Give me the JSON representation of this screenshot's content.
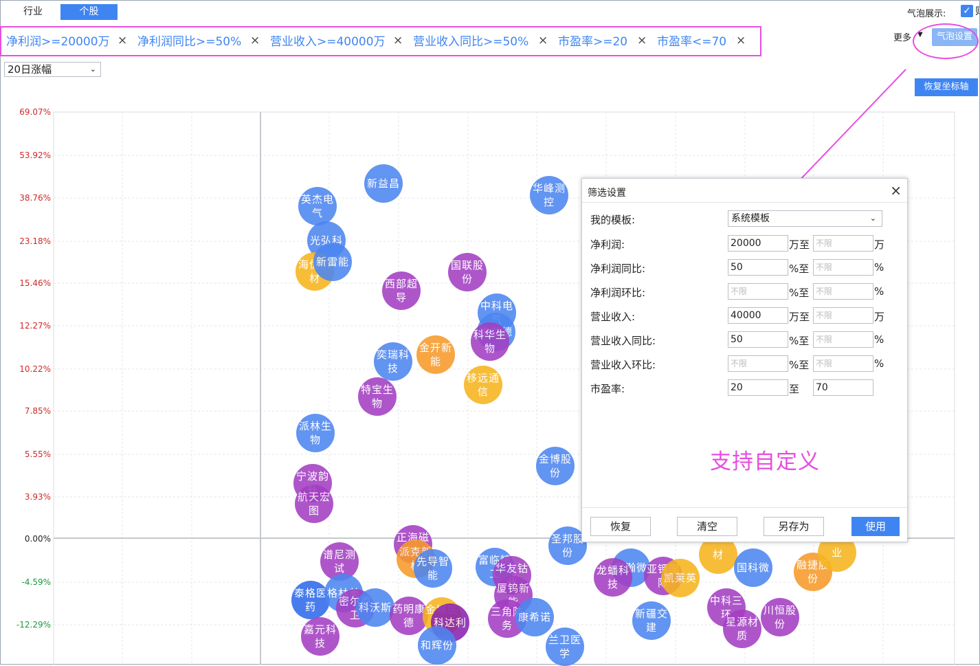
{
  "tabs": {
    "industry": "行业",
    "stock": "个股"
  },
  "bubble_toggle": {
    "label": "气泡展示:",
    "checked": true,
    "check_glyph": "✓",
    "clipped": "则"
  },
  "filters": [
    {
      "label": "净利润>=20000万"
    },
    {
      "label": "净利润同比>=50%"
    },
    {
      "label": "营业收入>=40000万"
    },
    {
      "label": "营业收入同比>=50%"
    },
    {
      "label": "市盈率>=20"
    },
    {
      "label": "市盈率<=70"
    }
  ],
  "filter_remove_glyph": "×",
  "more": {
    "label": "更多",
    "arrow": "▼"
  },
  "bubble_settings_label": "气泡设置",
  "reset_axis_label": "恢复坐标轴",
  "metric_select": {
    "value": "20日涨幅",
    "chev": "⌄"
  },
  "y_ticks": [
    "69.07%",
    "53.92%",
    "38.76%",
    "23.18%",
    "15.46%",
    "12.27%",
    "10.22%",
    "7.85%",
    "5.55%",
    "3.93%",
    "0.00%",
    "-4.59%",
    "-12.29%"
  ],
  "bubbles": [
    {
      "t": "新益昌",
      "c": "#4d86f0"
    },
    {
      "t": "英杰电气",
      "c": "#4d86f0"
    },
    {
      "t": "光弘科",
      "c": "#4d86f0"
    },
    {
      "t": "海优新材",
      "c": "#f7b51e"
    },
    {
      "t": "新雷能",
      "c": "#4d86f0"
    },
    {
      "t": "西部超导",
      "c": "#a33fc2"
    },
    {
      "t": "国联股份",
      "c": "#a33fc2"
    },
    {
      "t": "华峰测控",
      "c": "#4d86f0"
    },
    {
      "t": "中科电气",
      "c": "#4d86f0"
    },
    {
      "t": "宝兰德",
      "c": "#4d86f0"
    },
    {
      "t": "科华生物",
      "c": "#a33fc2"
    },
    {
      "t": "奕瑞科技",
      "c": "#4d86f0"
    },
    {
      "t": "金开新能",
      "c": "#f79a2a"
    },
    {
      "t": "移远通信",
      "c": "#f7b51e"
    },
    {
      "t": "特宝生物",
      "c": "#a33fc2"
    },
    {
      "t": "派林生物",
      "c": "#4d86f0"
    },
    {
      "t": "金博股份",
      "c": "#4d86f0"
    },
    {
      "t": "宁波韵升",
      "c": "#a33fc2"
    },
    {
      "t": "航天宏图",
      "c": "#a33fc2"
    },
    {
      "t": "正海磁材",
      "c": "#a33fc2"
    },
    {
      "t": "派克新材",
      "c": "#f79a2a"
    },
    {
      "t": "先导智能",
      "c": "#4d86f0"
    },
    {
      "t": "谱尼测试",
      "c": "#a33fc2"
    },
    {
      "t": "富临精工",
      "c": "#4d86f0"
    },
    {
      "t": "华友钴业",
      "c": "#a33fc2"
    },
    {
      "t": "厦钨新能",
      "c": "#a33fc2"
    },
    {
      "t": "圣邦股份",
      "c": "#4d86f0"
    },
    {
      "t": "泰格医药",
      "c": "#2f6bea"
    },
    {
      "t": "格林美",
      "c": "#4d86f0"
    },
    {
      "t": "密尔克卫",
      "c": "#a33fc2"
    },
    {
      "t": "科沃斯",
      "c": "#4d86f0"
    },
    {
      "t": "药明康德",
      "c": "#a33fc2"
    },
    {
      "t": "金域医学",
      "c": "#f7b51e"
    },
    {
      "t": "科达利",
      "c": "#8a23b0"
    },
    {
      "t": "嘉元科技",
      "c": "#a33fc2"
    },
    {
      "t": "三角防务",
      "c": "#a33fc2"
    },
    {
      "t": "康希诺",
      "c": "#4d86f0"
    },
    {
      "t": "和辉份",
      "c": "#4d86f0"
    },
    {
      "t": "兰卫医学",
      "c": "#4d86f0"
    },
    {
      "t": "富瀚微",
      "c": "#4d86f0"
    },
    {
      "t": "龙蟠科技",
      "c": "#a33fc2"
    },
    {
      "t": "亚钾国际",
      "c": "#a33fc2"
    },
    {
      "t": "凯莱英",
      "c": "#f7b51e"
    },
    {
      "t": "新疆交建",
      "c": "#4d86f0"
    },
    {
      "t": "材",
      "c": "#f7b51e"
    },
    {
      "t": "国科微",
      "c": "#4d86f0"
    },
    {
      "t": "融捷股份",
      "c": "#f79a2a"
    },
    {
      "t": "中科三环",
      "c": "#a33fc2"
    },
    {
      "t": "星源材质",
      "c": "#a33fc2"
    },
    {
      "t": "川恒股份",
      "c": "#a33fc2"
    },
    {
      "t": "业",
      "c": "#f7b51e"
    }
  ],
  "dialog": {
    "title": "筛选设置",
    "close_glyph": "×",
    "template_label": "我的模板:",
    "template_value": "系统模板",
    "placeholder": "不限",
    "rows": [
      {
        "label": "净利润:",
        "from": "20000",
        "to": "",
        "unit_mid": "万至",
        "unit_end": "万"
      },
      {
        "label": "净利润同比:",
        "from": "50",
        "to": "",
        "unit_mid": "%至",
        "unit_end": "%"
      },
      {
        "label": "净利润环比:",
        "from": "",
        "to": "",
        "unit_mid": "%至",
        "unit_end": "%"
      },
      {
        "label": "营业收入:",
        "from": "40000",
        "to": "",
        "unit_mid": "万至",
        "unit_end": "万"
      },
      {
        "label": "营业收入同比:",
        "from": "50",
        "to": "",
        "unit_mid": "%至",
        "unit_end": "%"
      },
      {
        "label": "营业收入环比:",
        "from": "",
        "to": "",
        "unit_mid": "%至",
        "unit_end": "%"
      },
      {
        "label": "市盈率:",
        "from": "20",
        "to": "70",
        "unit_mid": "至",
        "unit_end": ""
      }
    ],
    "custom_note": "支持自定义",
    "buttons": {
      "restore": "恢复",
      "clear": "清空",
      "save_as": "另存为",
      "apply": "使用"
    }
  },
  "colors": {
    "accent": "#3f85f2",
    "highlight": "#e84ee0",
    "positive": "#d02828",
    "negative": "#189a3a"
  }
}
